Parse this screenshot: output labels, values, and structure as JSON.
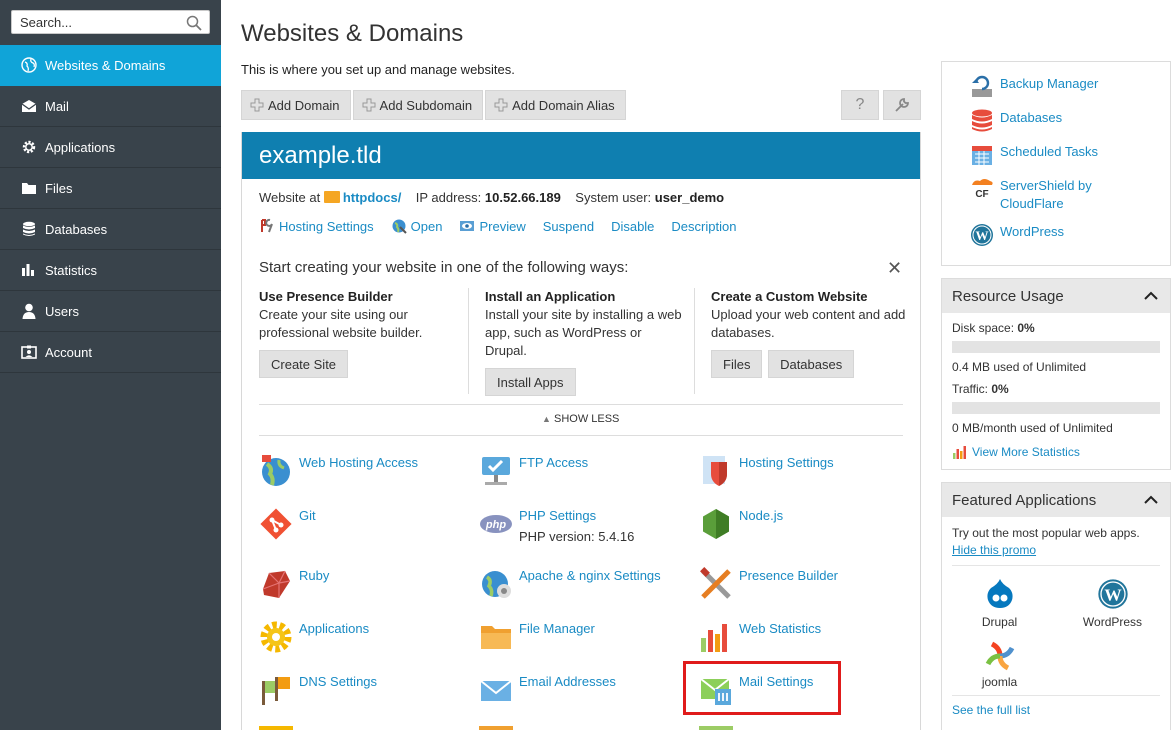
{
  "search": {
    "placeholder": "Search..."
  },
  "sidebar": {
    "items": [
      {
        "label": "Websites & Domains"
      },
      {
        "label": "Mail"
      },
      {
        "label": "Applications"
      },
      {
        "label": "Files"
      },
      {
        "label": "Databases"
      },
      {
        "label": "Statistics"
      },
      {
        "label": "Users"
      },
      {
        "label": "Account"
      }
    ]
  },
  "header": {
    "title": "Websites & Domains",
    "description": "This is where you set up and manage websites."
  },
  "toolbar": {
    "add_domain": "Add Domain",
    "add_subdomain": "Add Subdomain",
    "add_domain_alias": "Add Domain Alias"
  },
  "domain": {
    "name": "example.tld",
    "website_at_label": "Website at",
    "docroot": "httpdocs/",
    "ip_label": "IP address:",
    "ip": "10.52.66.189",
    "user_label": "System user:",
    "user": "user_demo",
    "actions": {
      "hosting_settings": "Hosting Settings",
      "open": "Open",
      "preview": "Preview",
      "suspend": "Suspend",
      "disable": "Disable",
      "description": "Description"
    }
  },
  "start": {
    "title": "Start creating your website in one of the following ways:",
    "presence": {
      "heading": "Use Presence Builder",
      "text": "Create your site using our professional website builder.",
      "button": "Create Site"
    },
    "install": {
      "heading": "Install an Application",
      "text": "Install your site by installing a web app, such as WordPress or Drupal.",
      "button": "Install Apps"
    },
    "custom": {
      "heading": "Create a Custom Website",
      "text": "Upload your web content and add databases.",
      "button_files": "Files",
      "button_databases": "Databases"
    },
    "show_less": "SHOW LESS"
  },
  "tools": {
    "web_hosting_access": "Web Hosting Access",
    "ftp_access": "FTP Access",
    "hosting_settings": "Hosting Settings",
    "git": "Git",
    "php_settings": "PHP Settings",
    "php_version": "PHP version: 5.4.16",
    "nodejs": "Node.js",
    "ruby": "Ruby",
    "apache_nginx": "Apache & nginx Settings",
    "presence_builder": "Presence Builder",
    "applications": "Applications",
    "file_manager": "File Manager",
    "web_statistics": "Web Statistics",
    "dns_settings": "DNS Settings",
    "email_addresses": "Email Addresses",
    "mail_settings": "Mail Settings"
  },
  "right": {
    "links": {
      "backup_manager": "Backup Manager",
      "databases": "Databases",
      "scheduled_tasks": "Scheduled Tasks",
      "servershield_line1": "ServerShield by",
      "servershield_line2": "CloudFlare",
      "wordpress": "WordPress"
    },
    "resource": {
      "title": "Resource Usage",
      "disk_label": "Disk space:",
      "disk_value": "0%",
      "disk_used": "0.4 MB used of Unlimited",
      "disk_fraction": 0.0,
      "traffic_label": "Traffic:",
      "traffic_value": "0%",
      "traffic_used": "0 MB/month used of Unlimited",
      "traffic_fraction": 0.0,
      "more_stats": "View More Statistics"
    },
    "featured": {
      "title": "Featured Applications",
      "intro": "Try out the most popular web apps.",
      "hide": "Hide this promo",
      "apps": [
        "Drupal",
        "WordPress",
        "joomla"
      ],
      "see_full": "See the full list"
    }
  }
}
